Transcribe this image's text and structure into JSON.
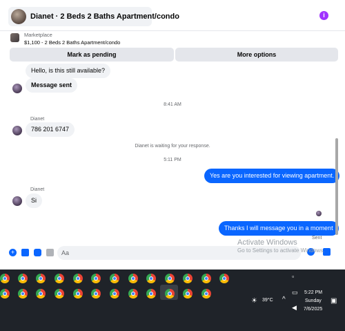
{
  "header": {
    "title": "Dianet · 2 Beds 2 Baths Apartment/condo",
    "info_icon": "info-icon"
  },
  "marketplace": {
    "label": "Marketplace",
    "listing": "$1,100 - 2 Beds 2 Baths Apartment/condo",
    "mark_pending": "Mark as pending",
    "more_options": "More options"
  },
  "messages": {
    "m1": "Hello, is this still available?",
    "m2": "Message sent",
    "time1": "8:41 AM",
    "sender1": "Dianet",
    "m3": "786 201 6747",
    "waiting": "Dianet is waiting for your response.",
    "time2": "5:11 PM",
    "m4": "Yes are you interested for viewing apartment.",
    "sender2": "Dianet",
    "m5": "Si",
    "m6": "Thanks I will message you in a moment",
    "status": "Sent"
  },
  "composer": {
    "placeholder": "Aa",
    "watermark_title": "Activate Windows",
    "watermark_sub": "Go to Settings to activate Windows."
  },
  "taskbar": {
    "weather": "39°C",
    "time": "5:22 PM",
    "day": "Sunday",
    "date": "7/6/2025"
  },
  "colors": {
    "accent": "#0a66ff",
    "info": "#a033ff",
    "taskbar": "#1f2329"
  }
}
